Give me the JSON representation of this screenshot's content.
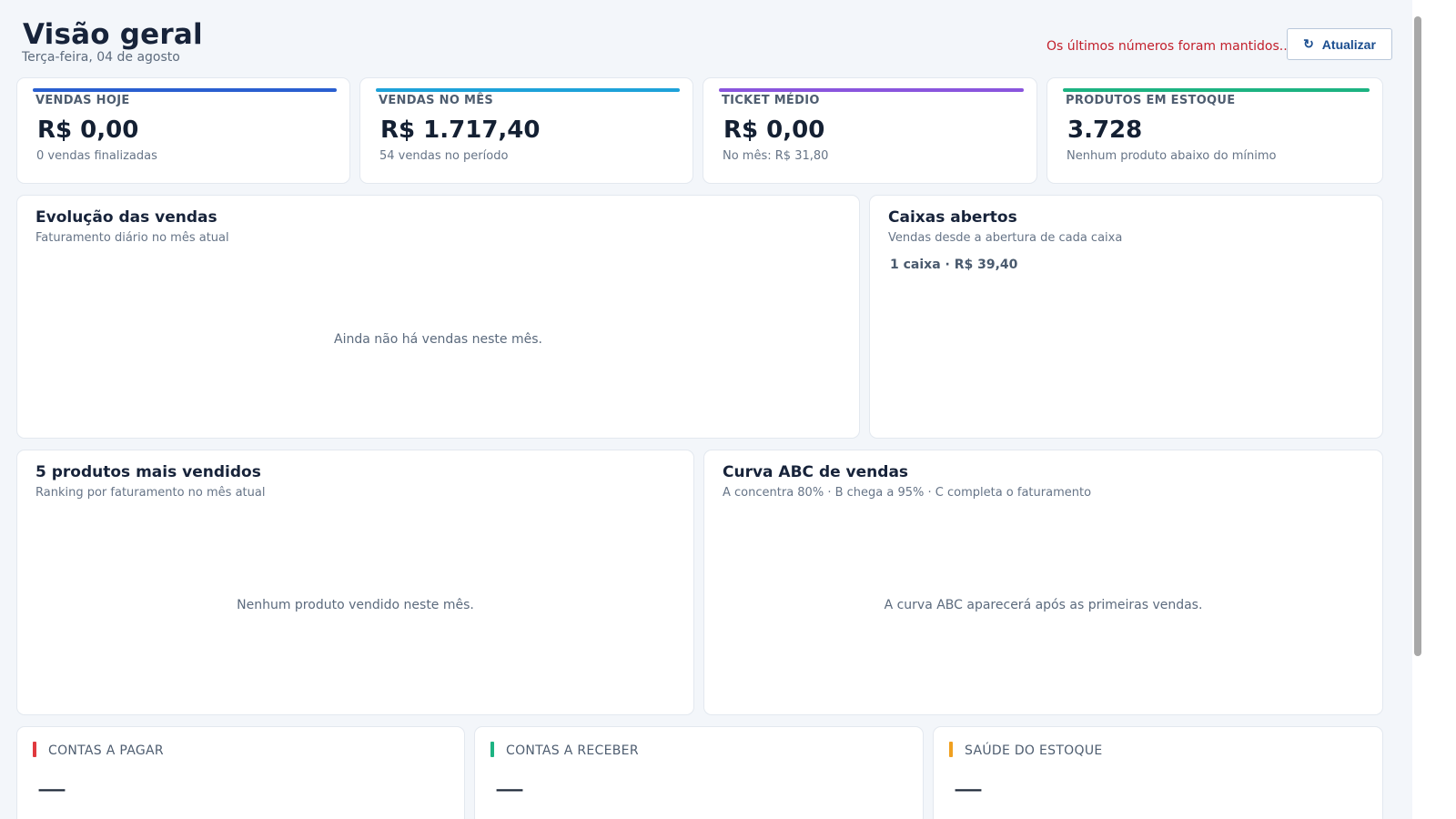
{
  "header": {
    "title": "Visão geral",
    "date": "Terça-feira, 04 de agosto",
    "stale_message": "Os últimos números foram mantidos...",
    "refresh_label": "Atualizar",
    "refresh_icon": "refresh-icon"
  },
  "kpis": [
    {
      "label": "VENDAS HOJE",
      "value": "R$ 0,00",
      "sub": "0 vendas finalizadas",
      "color": "#2a5fd0"
    },
    {
      "label": "VENDAS NO MÊS",
      "value": "R$ 1.717,40",
      "sub": "54 vendas no período",
      "color": "#1ea2d9"
    },
    {
      "label": "TICKET MÉDIO",
      "value": "R$ 0,00",
      "sub": "No mês: R$ 31,80",
      "color": "#8a55dd"
    },
    {
      "label": "PRODUTOS EM ESTOQUE",
      "value": "3.728",
      "sub": "Nenhum produto abaixo do mínimo",
      "color": "#1db382"
    }
  ],
  "evolucao": {
    "title": "Evolução das vendas",
    "subtitle": "Faturamento diário no mês atual",
    "empty": "Ainda não há vendas neste mês."
  },
  "caixas": {
    "title": "Caixas abertos",
    "subtitle": "Vendas desde a abertura de cada caixa",
    "summary": "1 caixa · R$ 39,40"
  },
  "top_produtos": {
    "title": "5 produtos mais vendidos",
    "subtitle": "Ranking por faturamento no mês atual",
    "empty": "Nenhum produto vendido neste mês."
  },
  "curva_abc": {
    "title": "Curva ABC de vendas",
    "subtitle": "A concentra 80% · B chega a 95% · C completa o faturamento",
    "empty": "A curva ABC aparecerá após as primeiras vendas."
  },
  "mini_cards": [
    {
      "label": "CONTAS A PAGAR",
      "value": "—",
      "color": "#e0393e"
    },
    {
      "label": "CONTAS A RECEBER",
      "value": "—",
      "color": "#1db382"
    },
    {
      "label": "SAÚDE DO ESTOQUE",
      "value": "—",
      "color": "#f0a020"
    }
  ]
}
